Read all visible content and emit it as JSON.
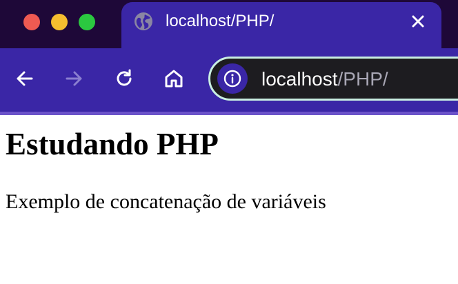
{
  "browser": {
    "tab": {
      "title": "localhost/PHP/",
      "favicon": "globe-icon"
    },
    "toolbar": {
      "back_icon": "arrow-left-icon",
      "forward_icon": "arrow-right-icon",
      "reload_icon": "reload-icon",
      "home_icon": "home-icon",
      "site_info_icon": "info-icon"
    },
    "address_bar": {
      "host": "localhost",
      "path": "/PHP/"
    },
    "colors": {
      "tabstrip": "#1e0838",
      "active_tab": "#3a26a6",
      "omnibox_border": "#c9eee2",
      "omnibox_bg": "#1d1c20"
    }
  },
  "page": {
    "heading": "Estudando PHP",
    "paragraph": "Exemplo de concatenação de variáveis"
  }
}
